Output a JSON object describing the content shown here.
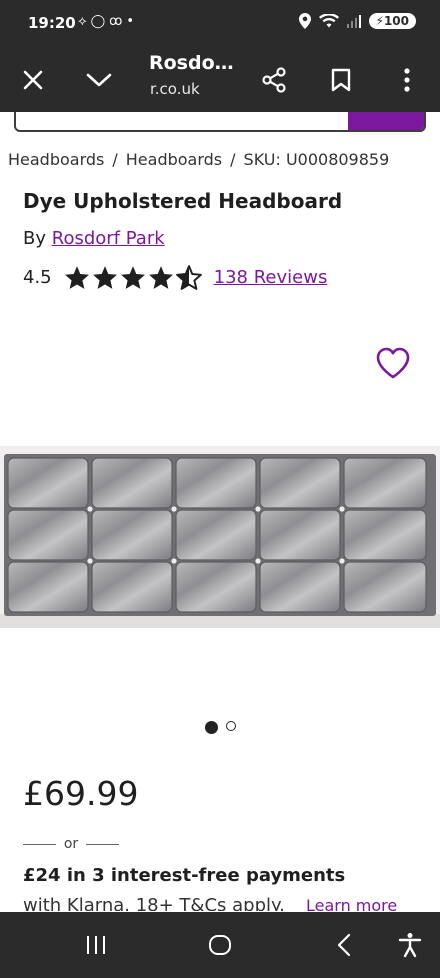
{
  "status_bar": {
    "time": "19:20",
    "left_icons": [
      "navigation-icon",
      "whatsapp-icon",
      "voicemail-icon",
      "dot-icon"
    ],
    "right_icons": [
      "location-icon",
      "wifi-icon",
      "signal-icon"
    ],
    "battery": "100"
  },
  "browser": {
    "title": "Rosdo…",
    "url": "r.co.uk",
    "icons": [
      "close-icon",
      "chevron-down-icon",
      "share-icon",
      "bookmark-icon",
      "more-vert-icon"
    ]
  },
  "breadcrumb": {
    "items": [
      "Headboards",
      "Headboards",
      "SKU: U000809859"
    ],
    "separator": "/"
  },
  "product": {
    "title": "Dye Upholstered Headboard",
    "by_prefix": "By",
    "brand": "Rosdorf Park",
    "rating": "4.5",
    "stars_filled": 4.5,
    "stars_total": 5,
    "reviews": "138 Reviews",
    "price": "£69.99",
    "image_count": 2,
    "image_active": 1
  },
  "klarna": {
    "or_label": "or",
    "title": "£24 in 3 interest-free payments",
    "subtitle": "with Klarna. 18+ T&Cs apply.",
    "learn_more": "Learn more"
  },
  "colors": {
    "accent": "#7b189f",
    "bar_bg": "#2b2b2b",
    "star": "#1f1f1f"
  },
  "nav_bar": {
    "icons": [
      "recent-apps-icon",
      "home-icon",
      "back-icon",
      "accessibility-icon"
    ]
  }
}
